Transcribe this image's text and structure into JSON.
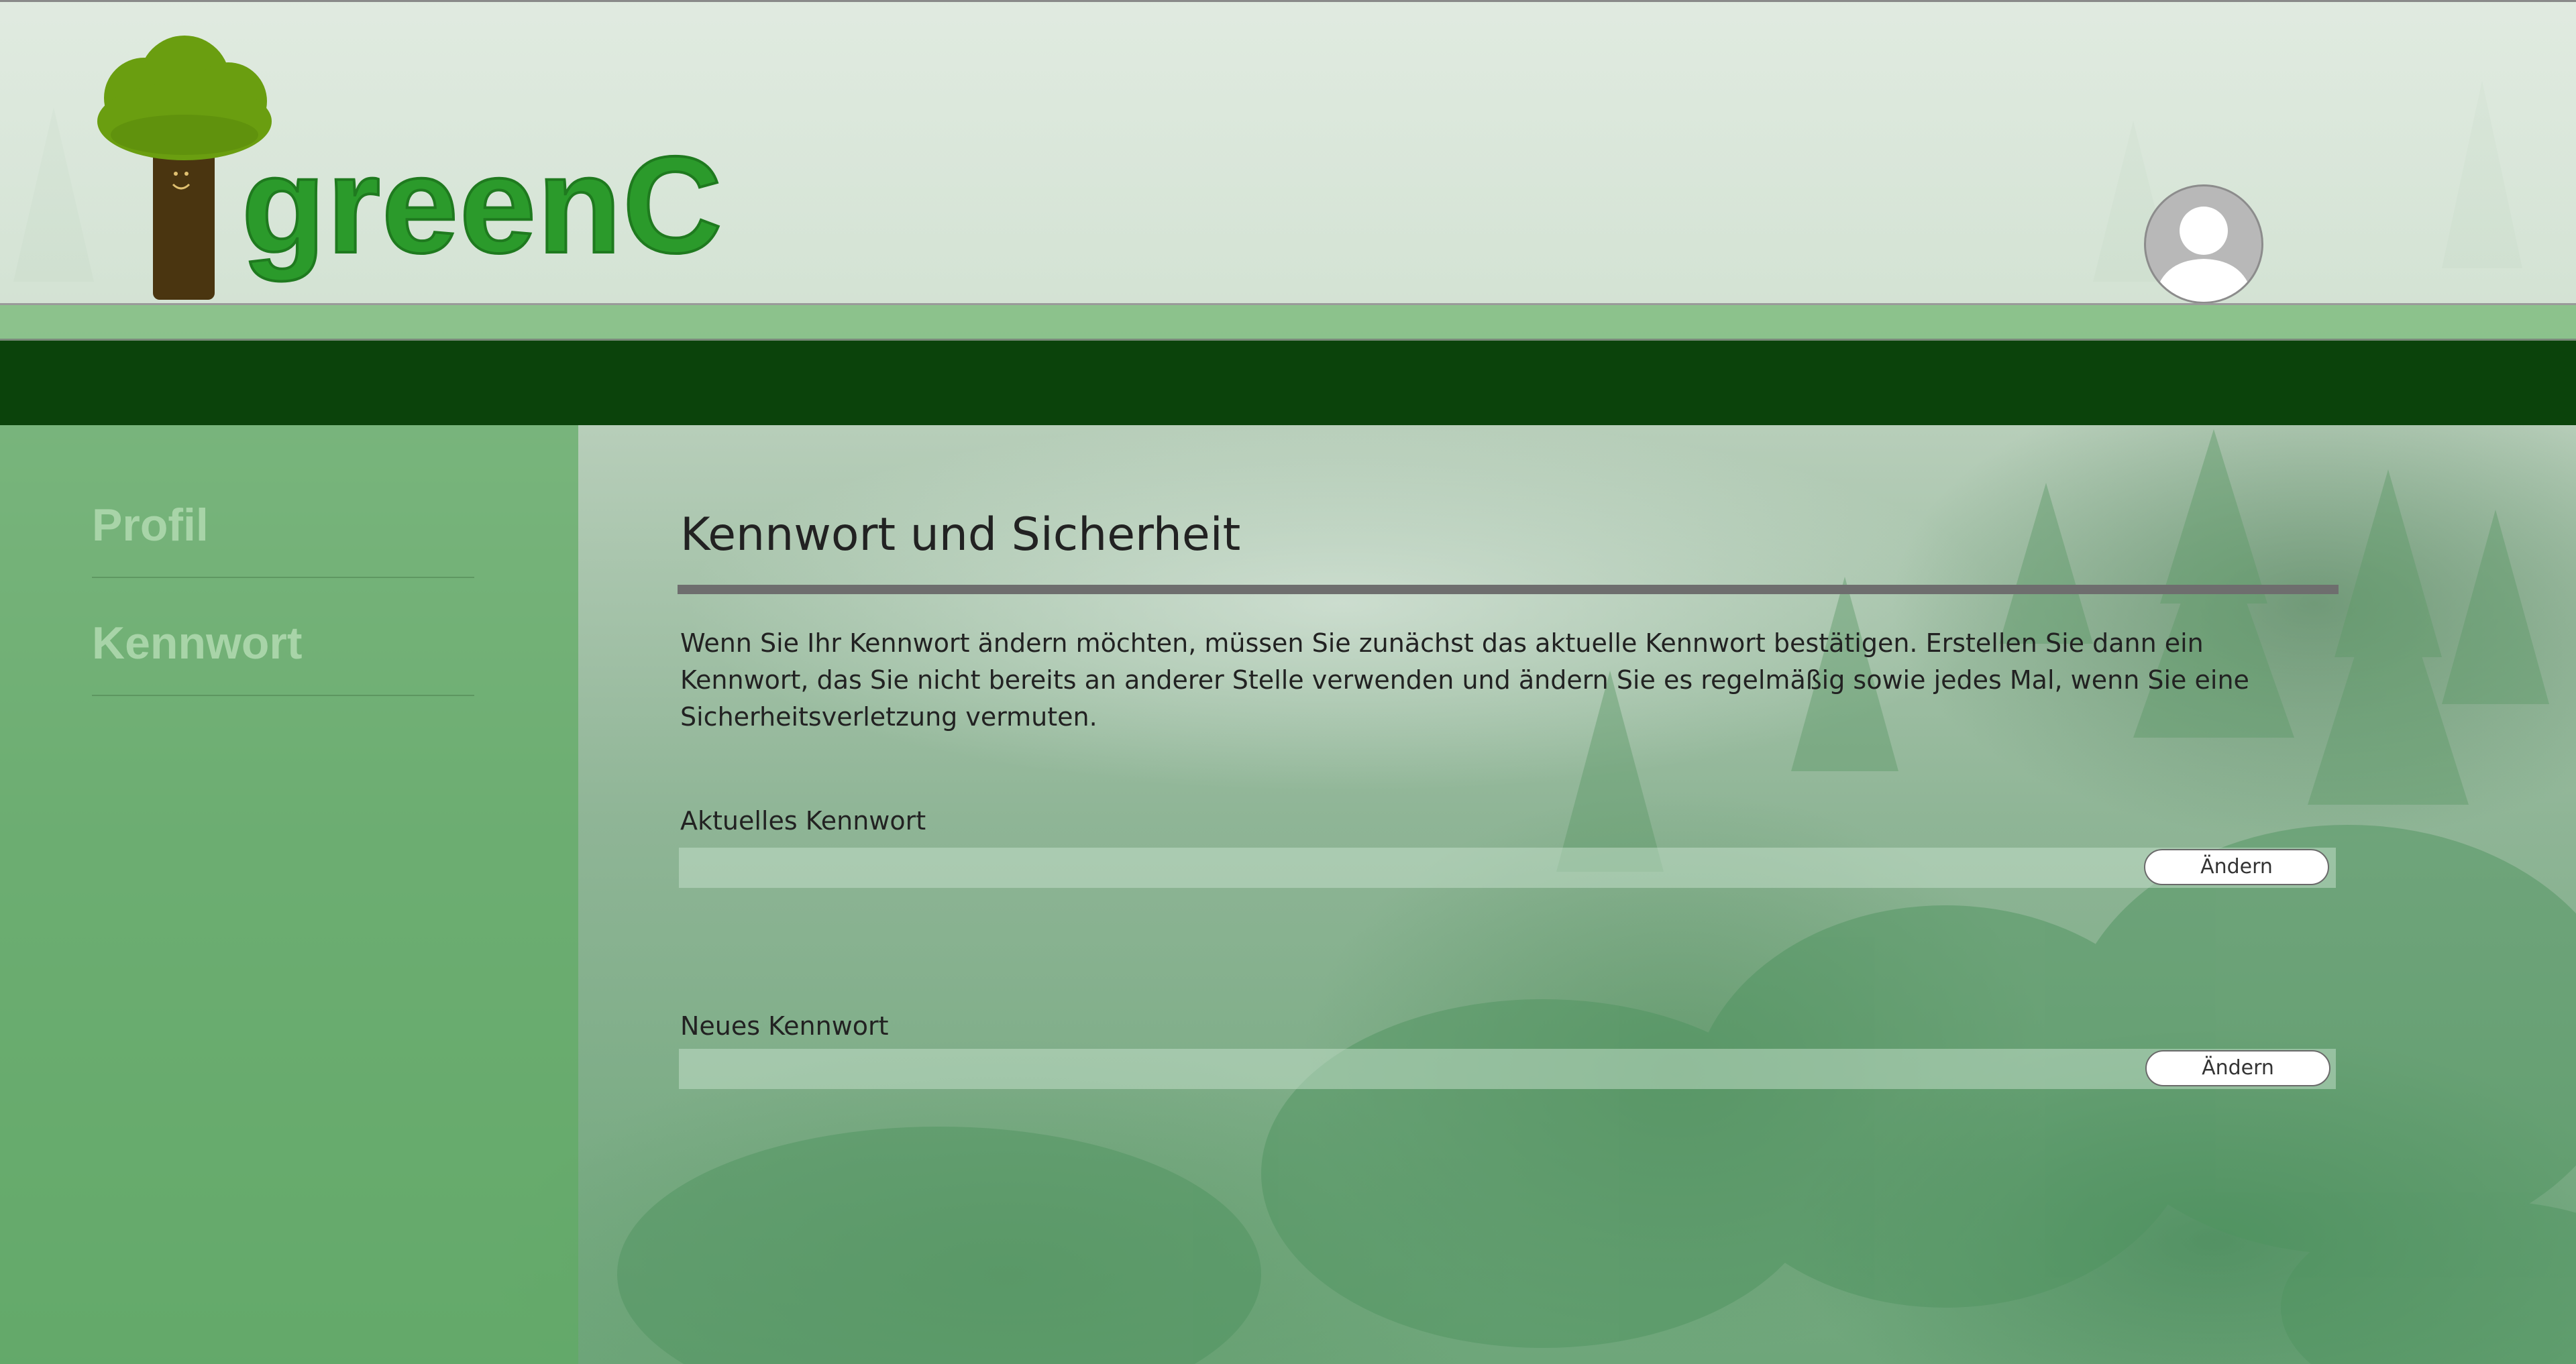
{
  "header": {
    "brand": "greenC",
    "logo_icon": "tree-logo-icon",
    "avatar_icon": "user-avatar-icon"
  },
  "sidebar": {
    "items": [
      {
        "label": "Profil"
      },
      {
        "label": "Kennwort"
      }
    ]
  },
  "main": {
    "title": "Kennwort und Sicherheit",
    "description": "Wenn Sie Ihr Kennwort ändern möchten, müssen Sie zunächst das aktuelle Kennwort bestätigen. Erstellen Sie dann ein Kennwort, das Sie nicht bereits an anderer Stelle verwenden und ändern Sie es regelmäßig sowie jedes Mal, wenn Sie eine Sicherheitsverletzung vermuten.",
    "fields": [
      {
        "label": "Aktuelles Kennwort",
        "value": "",
        "button_label": "Ändern"
      },
      {
        "label": "Neues Kennwort",
        "value": "",
        "button_label": "Ändern"
      }
    ]
  },
  "colors": {
    "brand_green": "#2b9a2b",
    "dark_bar": "#0b430b",
    "sidebar_green": "#5faa64",
    "sidebar_text": "#a8d4a8"
  }
}
